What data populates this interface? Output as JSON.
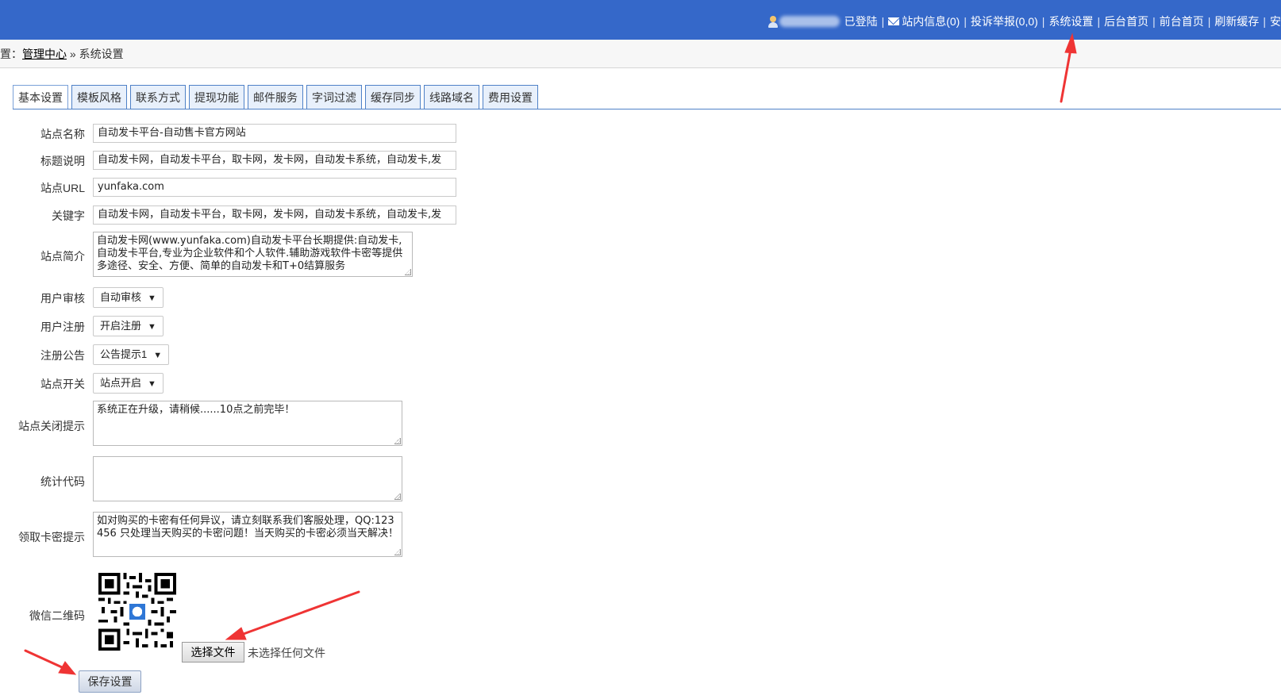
{
  "topnav": {
    "status": "已登陆",
    "messages": "站内信息(0)",
    "reports": "投诉举报(0,0)",
    "system_settings": "系统设置",
    "admin_home": "后台首页",
    "front_home": "前台首页",
    "refresh_cache": "刷新缓存",
    "truncated": "安"
  },
  "breadcrumb": {
    "prefix": "置：",
    "home": "管理中心",
    "separator": "»",
    "current": "系统设置"
  },
  "tabs": [
    "基本设置",
    "模板风格",
    "联系方式",
    "提现功能",
    "邮件服务",
    "字词过滤",
    "缓存同步",
    "线路域名",
    "费用设置"
  ],
  "form": {
    "site_name": {
      "label": "站点名称",
      "value": "自动发卡平台-自动售卡官方网站"
    },
    "title_desc": {
      "label": "标题说明",
      "value": "自动发卡网，自动发卡平台，取卡网，发卡网，自动发卡系统，自动发卡,发"
    },
    "site_url": {
      "label": "站点URL",
      "value": "yunfaka.com"
    },
    "keywords": {
      "label": "关键字",
      "value": "自动发卡网，自动发卡平台，取卡网，发卡网，自动发卡系统，自动发卡,发"
    },
    "site_intro": {
      "label": "站点简介",
      "value": "自动发卡网(www.yunfaka.com)自动发卡平台长期提供:自动发卡,自动发卡平台,专业为企业软件和个人软件.辅助游戏软件卡密等提供多途径、安全、方便、简单的自动发卡和T+0结算服务"
    },
    "user_review": {
      "label": "用户审核",
      "value": "自动审核"
    },
    "user_register": {
      "label": "用户注册",
      "value": "开启注册"
    },
    "register_notice": {
      "label": "注册公告",
      "value": "公告提示1"
    },
    "site_switch": {
      "label": "站点开关",
      "value": "站点开启"
    },
    "close_tip": {
      "label": "站点关闭提示",
      "value": "系统正在升级，请稍候......10点之前完毕！"
    },
    "stats_code": {
      "label": "统计代码",
      "value": ""
    },
    "card_tip": {
      "label": "领取卡密提示",
      "value": "如对购买的卡密有任何异议，请立刻联系我们客服处理，QQ:123456 只处理当天购买的卡密问题！当天购买的卡密必须当天解决！"
    },
    "wechat_qr": {
      "label": "微信二维码"
    }
  },
  "file": {
    "button": "选择文件",
    "status": "未选择任何文件"
  },
  "save_button": "保存设置",
  "colors": {
    "topbar": "#3568c9",
    "tab_border": "#4f81c7",
    "arrow": "#ef3434"
  }
}
